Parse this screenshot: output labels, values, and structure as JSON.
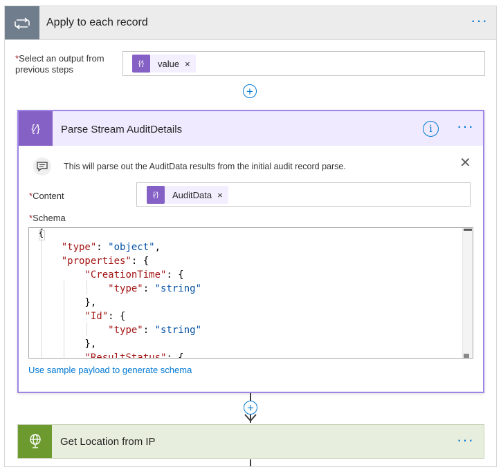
{
  "outer_card": {
    "title": "Apply to each record",
    "more_label": "···",
    "icon": "loop-icon"
  },
  "select_output": {
    "required_mark": "*",
    "label": "Select an output from previous steps",
    "token_label": "value",
    "token_icon": "{⁄}",
    "token_remove": "×"
  },
  "add_step_label": "+",
  "parse_card": {
    "title": "Parse Stream AuditDetails",
    "icon": "{⁄}",
    "info_label": "i",
    "more_label": "···",
    "comment": "This will parse out the AuditData results from the initial audit record parse.",
    "close_label": "✕",
    "content_label": "Content",
    "content_token": "AuditData",
    "content_token_remove": "×",
    "schema_label": "Schema",
    "schema_code": [
      "{",
      "    \"type\": \"object\",",
      "    \"properties\": {",
      "        \"CreationTime\": {",
      "            \"type\": \"string\"",
      "        },",
      "        \"Id\": {",
      "            \"type\": \"string\"",
      "        },",
      "        \"ResultStatus\": {"
    ],
    "sample_link": "Use sample payload to generate schema"
  },
  "location_card": {
    "title": "Get Location from IP",
    "more_label": "···",
    "icon": "globe-icon"
  },
  "colors": {
    "accent_blue": "#0078d4",
    "parse_purple": "#8661c5",
    "location_green": "#6c9a2f",
    "loop_gray": "#6f7d8c"
  }
}
